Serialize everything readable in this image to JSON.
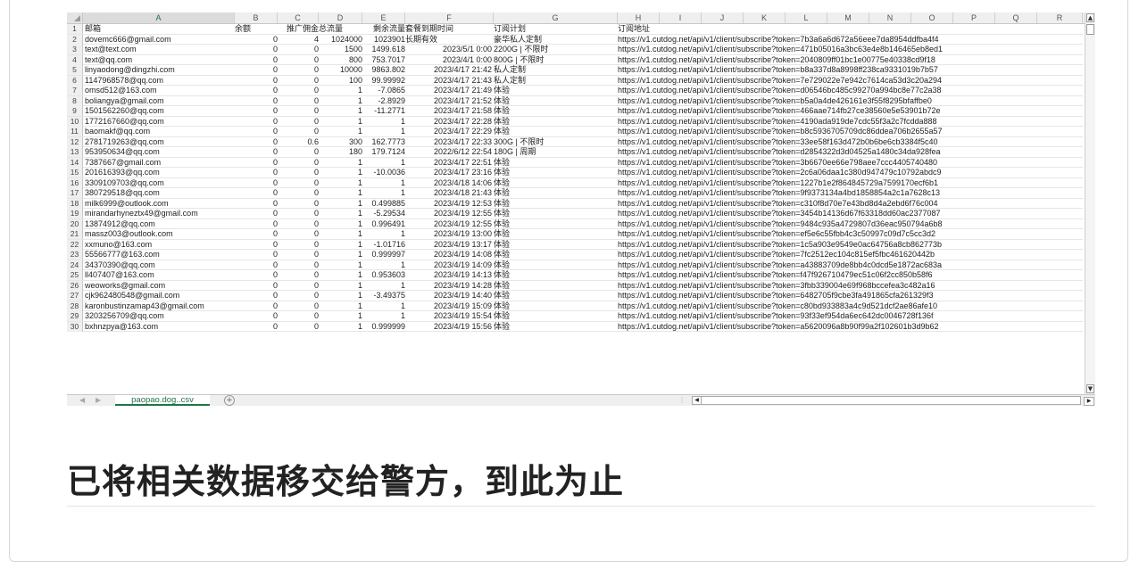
{
  "columns": [
    "A",
    "B",
    "C",
    "D",
    "E",
    "F",
    "G",
    "H",
    "I",
    "J",
    "K",
    "L",
    "M",
    "N",
    "O",
    "P",
    "Q",
    "R"
  ],
  "header_row": {
    "num": "1",
    "email": "邮箱",
    "balance": "余额",
    "commission": "推广佣金",
    "total": "总流量",
    "remaining": "剩余流量",
    "expiry": "套餐到期时间",
    "plan": "订阅计划",
    "url": "订阅地址"
  },
  "rows": [
    {
      "num": "2",
      "email": "dovemc666@gmail.com",
      "balance": "0",
      "commission": "4",
      "total": "1024000",
      "remaining": "1023901",
      "expiry": "长期有效",
      "expiry_align": "left",
      "plan": "豪华私人定制",
      "url": "https://v1.cutdog.net/api/v1/client/subscribe?token=7b3a6a6d672a56eee7da8954ddfba4f4"
    },
    {
      "num": "3",
      "email": "text@text.com",
      "balance": "0",
      "commission": "0",
      "total": "1500",
      "remaining": "1499.618",
      "expiry": "2023/5/1 0:00",
      "expiry_align": "right",
      "plan": "2200G | 不限时",
      "url": "https://v1.cutdog.net/api/v1/client/subscribe?token=471b05016a3bc63e4e8b146465eb8ed1"
    },
    {
      "num": "4",
      "email": "text@qq.com",
      "balance": "0",
      "commission": "0",
      "total": "800",
      "remaining": "753.7017",
      "expiry": "2023/4/1 0:00",
      "expiry_align": "right",
      "plan": "800G | 不限时",
      "url": "https://v1.cutdog.net/api/v1/client/subscribe?token=2040809ff01bc1e00775e40338cd9f18"
    },
    {
      "num": "5",
      "email": "linyaodong@dingzhi.com",
      "balance": "0",
      "commission": "0",
      "total": "10000",
      "remaining": "9863.802",
      "expiry": "2023/4/17 21:42",
      "expiry_align": "right",
      "plan": "私人定制",
      "url": "https://v1.cutdog.net/api/v1/client/subscribe?token=b8a337d8a8998ff238ca9331019b7b57"
    },
    {
      "num": "6",
      "email": "1147968578@qq.com",
      "balance": "0",
      "commission": "0",
      "total": "100",
      "remaining": "99.99992",
      "expiry": "2023/4/17 21:43",
      "expiry_align": "right",
      "plan": "私人定制",
      "url": "https://v1.cutdog.net/api/v1/client/subscribe?token=7e729022e7e942c7614ca53d3c20a294"
    },
    {
      "num": "7",
      "email": "omsd512@163.com",
      "balance": "0",
      "commission": "0",
      "total": "1",
      "remaining": "-7.0865",
      "expiry": "2023/4/17 21:49",
      "expiry_align": "right",
      "plan": "体验",
      "url": "https://v1.cutdog.net/api/v1/client/subscribe?token=d06546bc485c99270a994bc8e77c2a38"
    },
    {
      "num": "8",
      "email": "boliangya@gmail.com",
      "balance": "0",
      "commission": "0",
      "total": "1",
      "remaining": "-2.8929",
      "expiry": "2023/4/17 21:52",
      "expiry_align": "right",
      "plan": "体验",
      "url": "https://v1.cutdog.net/api/v1/client/subscribe?token=b5a0a4de426161e3f55f8295bfaffbe0"
    },
    {
      "num": "9",
      "email": "1501562260@qq.com",
      "balance": "0",
      "commission": "0",
      "total": "1",
      "remaining": "-11.2771",
      "expiry": "2023/4/17 21:58",
      "expiry_align": "right",
      "plan": "体验",
      "url": "https://v1.cutdog.net/api/v1/client/subscribe?token=466aae714fb27ce38560e5e53901b72e"
    },
    {
      "num": "10",
      "email": "1772167660@qq.com",
      "balance": "0",
      "commission": "0",
      "total": "1",
      "remaining": "1",
      "expiry": "2023/4/17 22:28",
      "expiry_align": "right",
      "plan": "体验",
      "url": "https://v1.cutdog.net/api/v1/client/subscribe?token=4190ada919de7cdc55f3a2c7fcdda888"
    },
    {
      "num": "11",
      "email": "baomakf@qq.com",
      "balance": "0",
      "commission": "0",
      "total": "1",
      "remaining": "1",
      "expiry": "2023/4/17 22:29",
      "expiry_align": "right",
      "plan": "体验",
      "url": "https://v1.cutdog.net/api/v1/client/subscribe?token=b8c5936705709dc86ddea706b2655a57"
    },
    {
      "num": "12",
      "email": "2781719263@qq.com",
      "balance": "0",
      "commission": "0.6",
      "total": "300",
      "remaining": "162.7773",
      "expiry": "2023/4/17 22:33",
      "expiry_align": "right",
      "plan": "300G | 不限时",
      "url": "https://v1.cutdog.net/api/v1/client/subscribe?token=33ee58f163d472b0b6be6cb3384f5c40"
    },
    {
      "num": "13",
      "email": "953950634@qq.com",
      "balance": "0",
      "commission": "0",
      "total": "180",
      "remaining": "179.7124",
      "expiry": "2022/6/12 22:54",
      "expiry_align": "right",
      "plan": "180G | 周期",
      "url": "https://v1.cutdog.net/api/v1/client/subscribe?token=d2854322d3d04525a1480c34da928fea"
    },
    {
      "num": "14",
      "email": "7387667@gmail.com",
      "balance": "0",
      "commission": "0",
      "total": "1",
      "remaining": "1",
      "expiry": "2023/4/17 22:51",
      "expiry_align": "right",
      "plan": "体验",
      "url": "https://v1.cutdog.net/api/v1/client/subscribe?token=3b6670ee66e798aee7ccc4405740480"
    },
    {
      "num": "15",
      "email": "201616393@qq.com",
      "balance": "0",
      "commission": "0",
      "total": "1",
      "remaining": "-10.0036",
      "expiry": "2023/4/17 23:16",
      "expiry_align": "right",
      "plan": "体验",
      "url": "https://v1.cutdog.net/api/v1/client/subscribe?token=2c6a06daa1c380d947479c10792abdc9"
    },
    {
      "num": "16",
      "email": "3309109703@qq.com",
      "balance": "0",
      "commission": "0",
      "total": "1",
      "remaining": "1",
      "expiry": "2023/4/18 14:06",
      "expiry_align": "right",
      "plan": "体验",
      "url": "https://v1.cutdog.net/api/v1/client/subscribe?token=1227b1e2f864845729a7599170ecf6b1"
    },
    {
      "num": "17",
      "email": "380729518@qq.com",
      "balance": "0",
      "commission": "0",
      "total": "1",
      "remaining": "1",
      "expiry": "2023/4/18 21:43",
      "expiry_align": "right",
      "plan": "体验",
      "url": "https://v1.cutdog.net/api/v1/client/subscribe?token=9f9373134a4bd1858854a2c1a7628c13"
    },
    {
      "num": "18",
      "email": "milk6999@outlook.com",
      "balance": "0",
      "commission": "0",
      "total": "1",
      "remaining": "0.499885",
      "expiry": "2023/4/19 12:53",
      "expiry_align": "right",
      "plan": "体验",
      "url": "https://v1.cutdog.net/api/v1/client/subscribe?token=c310f8d70e7e43bd8d4a2ebd6f76c004"
    },
    {
      "num": "19",
      "email": "mirandarhyneztx49@gmail.com",
      "balance": "0",
      "commission": "0",
      "total": "1",
      "remaining": "-5.29534",
      "expiry": "2023/4/19 12:55",
      "expiry_align": "right",
      "plan": "体验",
      "url": "https://v1.cutdog.net/api/v1/client/subscribe?token=3454b14136d67f63318dd60ac2377087"
    },
    {
      "num": "20",
      "email": "13874912@qq.com",
      "balance": "0",
      "commission": "0",
      "total": "1",
      "remaining": "0.996491",
      "expiry": "2023/4/19 12:55",
      "expiry_align": "right",
      "plan": "体验",
      "url": "https://v1.cutdog.net/api/v1/client/subscribe?token=9484c935a4729807d36eac950794a6b8"
    },
    {
      "num": "21",
      "email": "massz003@outlook.com",
      "balance": "0",
      "commission": "0",
      "total": "1",
      "remaining": "1",
      "expiry": "2023/4/19 13:00",
      "expiry_align": "right",
      "plan": "体验",
      "url": "https://v1.cutdog.net/api/v1/client/subscribe?token=ef5e6c55fbb4c3c50997c09d7c5cc3d2"
    },
    {
      "num": "22",
      "email": "xxmuno@163.com",
      "balance": "0",
      "commission": "0",
      "total": "1",
      "remaining": "-1.01716",
      "expiry": "2023/4/19 13:17",
      "expiry_align": "right",
      "plan": "体验",
      "url": "https://v1.cutdog.net/api/v1/client/subscribe?token=1c5a903e9549e0ac64756a8cb862773b"
    },
    {
      "num": "23",
      "email": "55566777@163.com",
      "balance": "0",
      "commission": "0",
      "total": "1",
      "remaining": "0.999997",
      "expiry": "2023/4/19 14:08",
      "expiry_align": "right",
      "plan": "体验",
      "url": "https://v1.cutdog.net/api/v1/client/subscribe?token=7fc2512ec104c815ef5fbc461620442b"
    },
    {
      "num": "24",
      "email": "34370390@qq.com",
      "balance": "0",
      "commission": "0",
      "total": "1",
      "remaining": "1",
      "expiry": "2023/4/19 14:09",
      "expiry_align": "right",
      "plan": "体验",
      "url": "https://v1.cutdog.net/api/v1/client/subscribe?token=a43883709de8bb4c0dcd5e1872ac683a"
    },
    {
      "num": "25",
      "email": "ll407407@163.com",
      "balance": "0",
      "commission": "0",
      "total": "1",
      "remaining": "0.953603",
      "expiry": "2023/4/19 14:13",
      "expiry_align": "right",
      "plan": "体验",
      "url": "https://v1.cutdog.net/api/v1/client/subscribe?token=f47f926710479ec51c06f2cc850b58f6"
    },
    {
      "num": "26",
      "email": "weoworks@gmail.com",
      "balance": "0",
      "commission": "0",
      "total": "1",
      "remaining": "1",
      "expiry": "2023/4/19 14:28",
      "expiry_align": "right",
      "plan": "体验",
      "url": "https://v1.cutdog.net/api/v1/client/subscribe?token=3fbb339004e69f968bccefea3c482a16"
    },
    {
      "num": "27",
      "email": "cjk962480548@gmail.com",
      "balance": "0",
      "commission": "0",
      "total": "1",
      "remaining": "-3.49375",
      "expiry": "2023/4/19 14:40",
      "expiry_align": "right",
      "plan": "体验",
      "url": "https://v1.cutdog.net/api/v1/client/subscribe?token=6482705f9cbe3fa491865cfa261329f3"
    },
    {
      "num": "28",
      "email": "karonbustinzamap43@gmail.com",
      "balance": "0",
      "commission": "0",
      "total": "1",
      "remaining": "1",
      "expiry": "2023/4/19 15:09",
      "expiry_align": "right",
      "plan": "体验",
      "url": "https://v1.cutdog.net/api/v1/client/subscribe?token=c80bd933883a4c9d521dcf2ae86afe10"
    },
    {
      "num": "29",
      "email": "3203256709@qq.com",
      "balance": "0",
      "commission": "0",
      "total": "1",
      "remaining": "1",
      "expiry": "2023/4/19 15:54",
      "expiry_align": "right",
      "plan": "体验",
      "url": "https://v1.cutdog.net/api/v1/client/subscribe?token=93f33ef954da6ec642dc0046728f136f"
    },
    {
      "num": "30",
      "email": "bxhnzpya@163.com",
      "balance": "0",
      "commission": "0",
      "total": "1",
      "remaining": "0.999999",
      "expiry": "2023/4/19 15:56",
      "expiry_align": "right",
      "plan": "体验",
      "url": "https://v1.cutdog.net/api/v1/client/subscribe?token=a5620096a8b90f99a2f102601b3d9b62"
    }
  ],
  "sheet_tab": "paopao.dog..csv",
  "add_sheet_symbol": "+",
  "caption": "已将相关数据移交给警方，到此为止",
  "colors": {
    "accent": "#217346",
    "header_bg": "#efefef"
  }
}
